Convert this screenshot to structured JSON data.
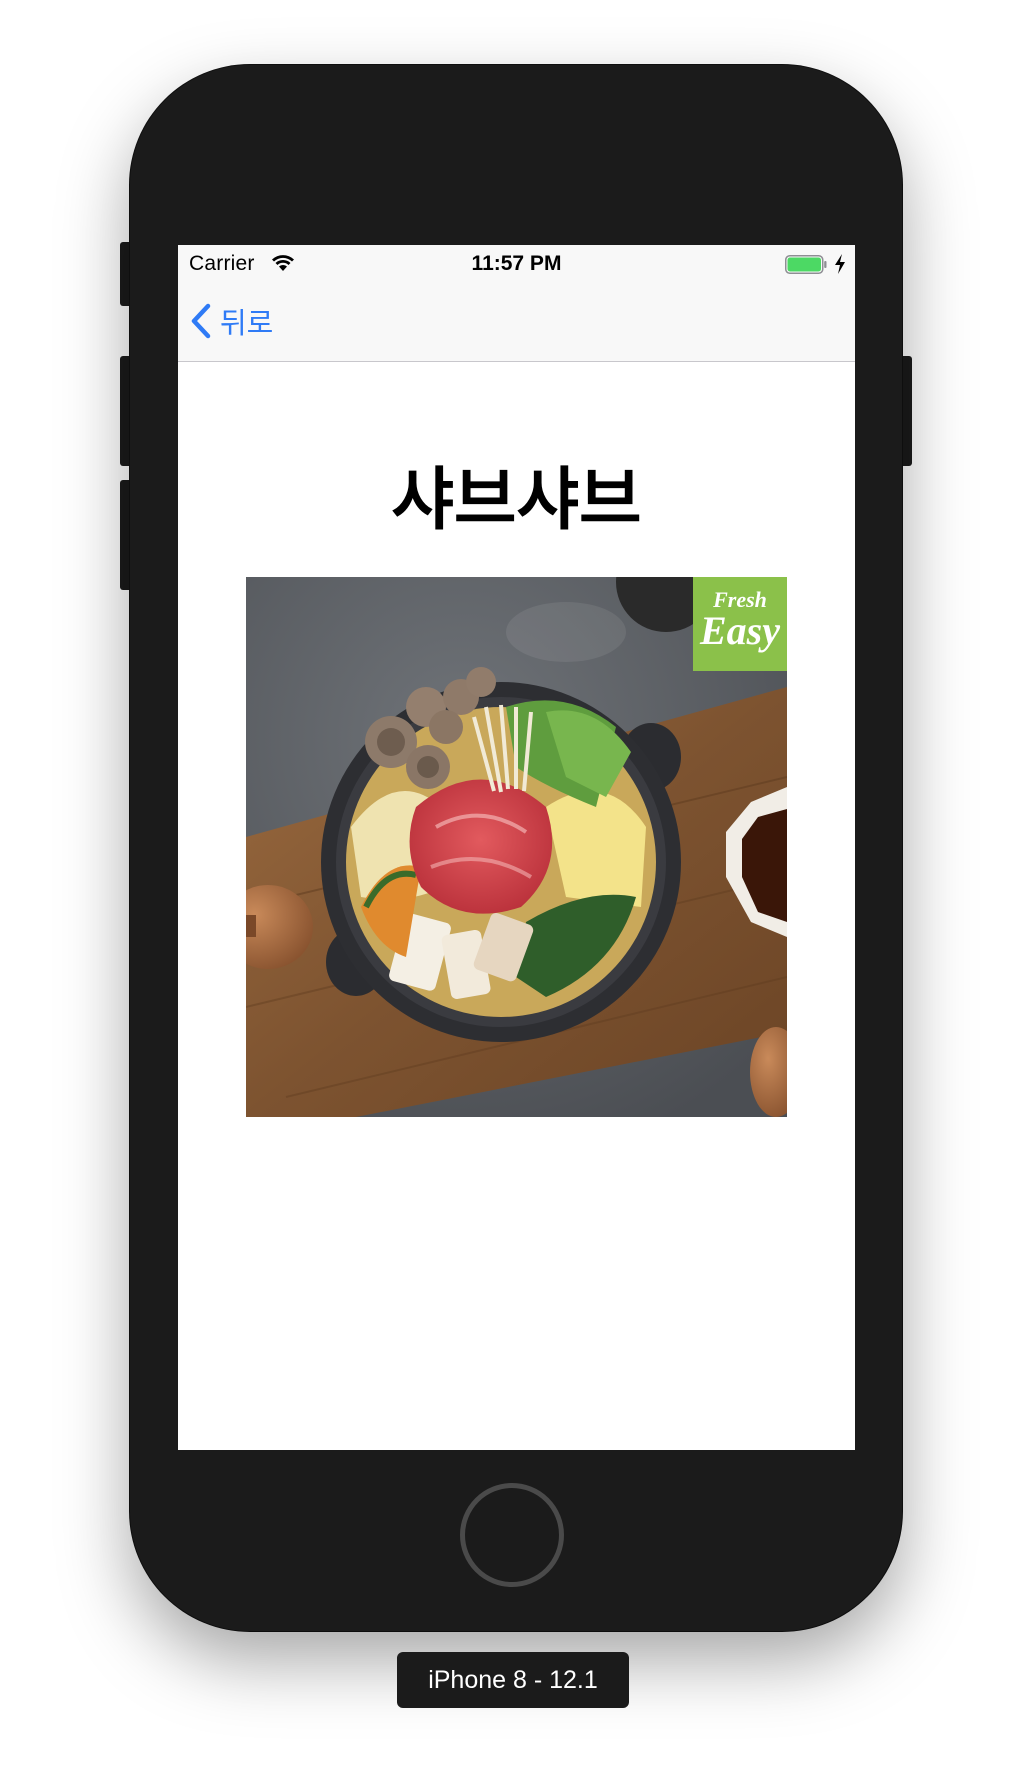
{
  "status_bar": {
    "carrier": "Carrier",
    "time": "11:57 PM",
    "wifi_icon": "wifi-icon",
    "battery_icon": "battery-icon",
    "battery_level": 1.0,
    "battery_color": "#4cd964"
  },
  "nav": {
    "back_label": "뒤로",
    "back_icon": "chevron-left-icon",
    "tint_color": "#2f7bf6"
  },
  "main": {
    "title": "샤브샤브",
    "photo": {
      "subject": "shabu-shabu hot pot",
      "badge_top": "Fresh",
      "badge_bottom": "Easy",
      "badge_color": "#8bc14a"
    }
  },
  "device": {
    "label": "iPhone 8 - 12.1"
  }
}
